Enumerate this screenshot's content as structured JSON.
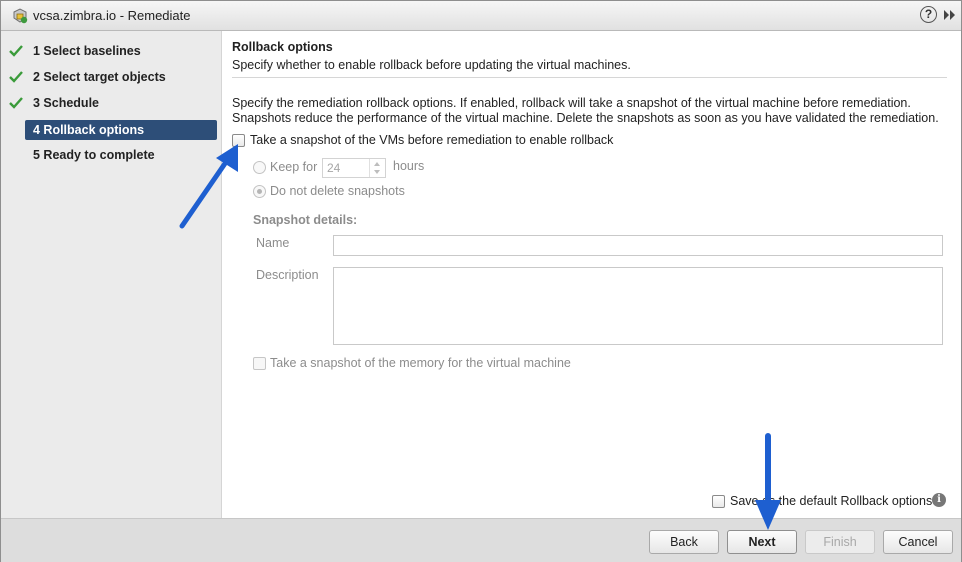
{
  "window": {
    "title": "vcsa.zimbra.io - Remediate",
    "help_label": "?"
  },
  "nav": {
    "steps": [
      {
        "label": "1  Select baselines",
        "done": true
      },
      {
        "label": "2  Select target objects",
        "done": true
      },
      {
        "label": "3  Schedule",
        "done": true
      },
      {
        "label": "4  Rollback options",
        "active": true
      },
      {
        "label": "5  Ready to complete"
      }
    ]
  },
  "section": {
    "title": "Rollback options",
    "subtitle": "Specify whether to enable rollback before updating the virtual machines.",
    "description": "Specify the remediation rollback options. If enabled, rollback will take a snapshot of the virtual machine before remediation. Snapshots reduce the performance of the virtual machine. Delete the snapshots as soon as you have validated the remediation."
  },
  "rollback": {
    "enable_label": "Take a snapshot of the VMs before remediation to enable rollback",
    "enable_checked": false,
    "keep_for_label": "Keep for",
    "keep_for_value": "24",
    "hours_label": "hours",
    "do_not_delete_label": "Do not delete snapshots",
    "selected_option": "do_not_delete"
  },
  "snapshot": {
    "details_label": "Snapshot details:",
    "name_label": "Name",
    "name_value": "",
    "description_label": "Description",
    "description_value": "",
    "memory_label": "Take a snapshot of the memory for the virtual machine"
  },
  "save_default": {
    "label": "Save as the default Rollback options",
    "checked": false,
    "info_glyph": "i"
  },
  "buttons": {
    "back": "Back",
    "next": "Next",
    "finish": "Finish",
    "cancel": "Cancel"
  },
  "colors": {
    "active_step": "#2d4e78",
    "check": "#3a9b3a",
    "annotation_arrow": "#1e5fd0"
  }
}
